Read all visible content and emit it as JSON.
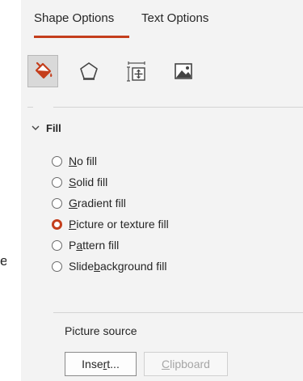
{
  "edge_text": "e",
  "tabs": {
    "shape_options": "Shape Options",
    "text_options": "Text Options"
  },
  "accent_color": "#c43e1c",
  "categories": [
    {
      "icon": "paint-bucket-icon",
      "selected": true
    },
    {
      "icon": "pentagon-icon",
      "selected": false
    },
    {
      "icon": "size-properties-icon",
      "selected": false
    },
    {
      "icon": "picture-icon",
      "selected": false
    }
  ],
  "fill_section": {
    "title": "Fill",
    "expanded": true,
    "options": [
      {
        "pre": "",
        "key": "N",
        "post": "o fill",
        "checked": false
      },
      {
        "pre": "",
        "key": "S",
        "post": "olid fill",
        "checked": false
      },
      {
        "pre": "",
        "key": "G",
        "post": "radient fill",
        "checked": false
      },
      {
        "pre": "",
        "key": "P",
        "post": "icture or texture fill",
        "checked": true
      },
      {
        "pre": "P",
        "key": "a",
        "post": "ttern fill",
        "checked": false
      },
      {
        "pre": "Slide ",
        "key": "b",
        "post": "ackground fill",
        "checked": false
      }
    ],
    "picture_source_label": "Picture source",
    "insert_button": {
      "pre": "Inse",
      "key": "r",
      "post": "t..."
    },
    "clipboard_button": {
      "pre": "",
      "key": "C",
      "post": "lipboard"
    }
  }
}
